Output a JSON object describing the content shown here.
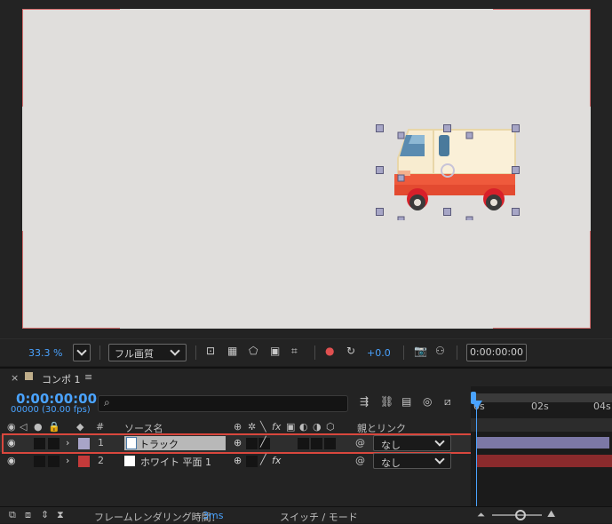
{
  "viewer": {
    "zoom": "33.3 %",
    "quality": "フル画質",
    "exposure": "+0.0",
    "timecode": "0:00:00:00"
  },
  "panel": {
    "close": "×",
    "tab": "コンポ 1",
    "menu": "≡"
  },
  "timeline": {
    "current_time": "0:00:00:00",
    "fps_frames": "00000 (30.00 fps)",
    "search_placeholder": "",
    "headers": {
      "num": "#",
      "source_name": "ソース名",
      "parent": "親とリンク"
    },
    "layers": [
      {
        "num": "1",
        "name": "トラック",
        "parent": "なし",
        "label_color": "#a8a4c8"
      },
      {
        "num": "2",
        "name": "ホワイト 平面 1",
        "parent": "なし",
        "label_color": "#c43a3a"
      }
    ],
    "ruler": [
      "0s",
      "02s",
      "04s"
    ]
  },
  "status": {
    "render_label": "フレームレンダリング時間：",
    "render_value": "3ms",
    "mode": "スイッチ / モード"
  },
  "colors": {
    "accent": "#4aa3ff",
    "highlight": "#d9473d"
  }
}
